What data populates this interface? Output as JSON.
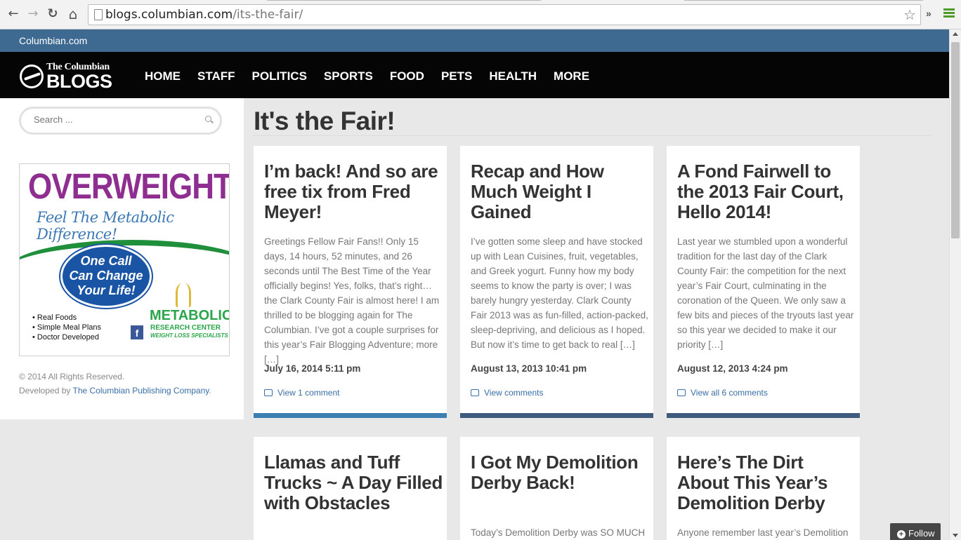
{
  "browser": {
    "back_icon": "←",
    "forward_icon": "→",
    "reload_icon": "↻",
    "home_icon": "⌂",
    "url_host": "blogs.columbian.com",
    "url_path": "/its-the-fair/",
    "star_icon": "☆",
    "chevrons": "»"
  },
  "topbar": {
    "site_link": "Columbian.com"
  },
  "logo": {
    "small": "The Columbian",
    "big": "BLOGS"
  },
  "nav": {
    "items": [
      "HOME",
      "STAFF",
      "POLITICS",
      "SPORTS",
      "FOOD",
      "PETS",
      "HEALTH",
      "MORE"
    ]
  },
  "sidebar": {
    "search_placeholder": "Search ...",
    "ad": {
      "headline": "OVERWEIGHT?",
      "sub": "Feel The Metabolic Difference!",
      "oval_line1": "One Call",
      "oval_line2": "Can Change",
      "oval_line3": "Your Life!",
      "bullet1": "• Real Foods",
      "bullet2": "• Simple Meal Plans",
      "bullet3": "• Doctor Developed",
      "brand": "METABOLIC",
      "brand2": "RESEARCH CENTER",
      "brand3": "WEIGHT LOSS SPECIALISTS"
    },
    "copyright": "© 2014 All Rights Reserved.",
    "developed_by": "Developed by ",
    "developer_link": "The Columbian Publishing Company",
    "period": "."
  },
  "page_title": "It's the Fair!",
  "posts": [
    {
      "title": "I’m back! And so are free tix from Fred Meyer!",
      "excerpt": "Greetings Fellow Fair Fans!! Only 15 days, 14 hours, 52 minutes, and 26 seconds until The Best Time of the Year officially begins!  Yes, folks, that’s right…the Clark County Fair is almost here! I am thrilled to be blogging again for The Columbian.  I’ve got a couple surprises for this year’s Fair Blogging Adventure; more […]",
      "date": "July 16, 2014 5:11 pm",
      "comments": "View 1 comment",
      "bar_color": "#3c7fb1"
    },
    {
      "title": "Recap and How Much Weight I Gained",
      "excerpt": "I’ve gotten some sleep and have stocked up with Lean Cuisines, fruit, vegetables, and Greek yogurt. Funny how my body seems to know the party is over; I was barely hungry yesterday. Clark County Fair 2013 was as fun-filled, action-packed, sleep-depriving, and delicious as I hoped. But now it’s time to get back to real […]",
      "date": "August 13, 2013 10:41 pm",
      "comments": "View comments",
      "bar_color": "#3e5a7c"
    },
    {
      "title": "A Fond Fairwell to the 2013 Fair Court, Hello 2014!",
      "excerpt": "Last year we stumbled upon a wonderful tradition for the last day of the Clark County Fair:  the competition for the next year’s Fair Court, culminating in the coronation of the Queen.  We only saw a few bits and pieces of the tryouts last year so this year we decided to make it our priority […]",
      "date": "August 12, 2013 4:24 pm",
      "comments": "View all 6 comments",
      "bar_color": "#3e5a7c"
    },
    {
      "title": "Llamas and Tuff Trucks ~ A Day Filled with Obstacles",
      "excerpt": "",
      "date": "",
      "comments": ""
    },
    {
      "title": "I Got My Demolition Derby Back!",
      "excerpt": "Today’s Demolition Derby was SO MUCH",
      "date": "",
      "comments": ""
    },
    {
      "title": "Here’s The Dirt About This Year’s Demolition Derby",
      "excerpt": "Anyone remember last year’s Demolition",
      "date": "",
      "comments": ""
    }
  ],
  "follow": {
    "label": "Follow",
    "icon": "+"
  }
}
